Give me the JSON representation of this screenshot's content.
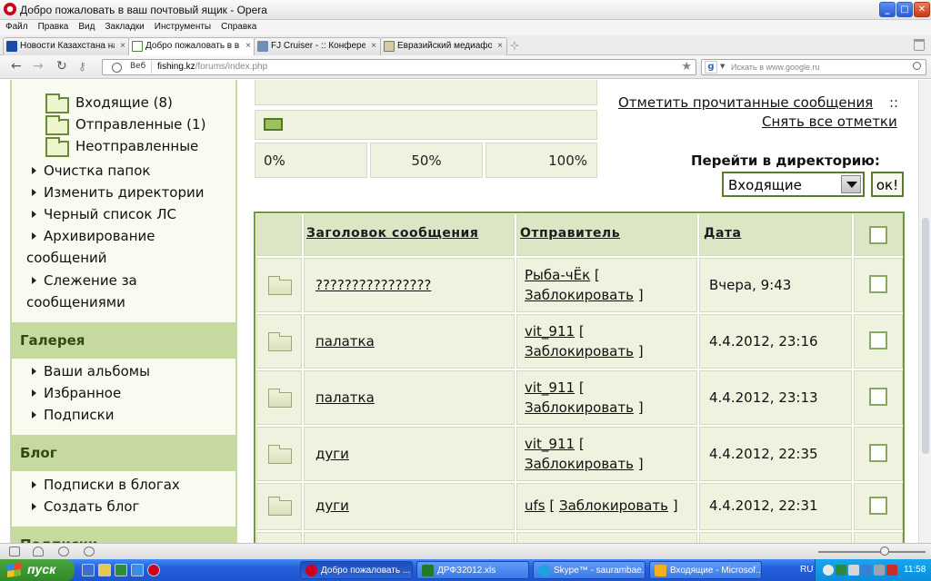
{
  "window": {
    "title": "Добро пожаловать в ваш почтовый ящик - Opera",
    "min_label": "_",
    "max_label": "□",
    "close_label": "✕"
  },
  "menu": [
    "Файл",
    "Правка",
    "Вид",
    "Закладки",
    "Инструменты",
    "Справка"
  ],
  "tabs": [
    {
      "label": "Новости Казахстана на...",
      "close": "×"
    },
    {
      "label": "Добро пожаловать в в...",
      "close": "×"
    },
    {
      "label": "FJ Cruiser - :: Конферен...",
      "close": "×"
    },
    {
      "label": "Евразийский медиафор...",
      "close": "×"
    }
  ],
  "address": {
    "badge": "Веб",
    "host": "fishing.kz",
    "path": "/forums/index.php",
    "search_placeholder": "Искать в www.google.ru",
    "search_engine": "g"
  },
  "sidebar": {
    "folders": [
      {
        "label": "Входящие (8)"
      },
      {
        "label": "Отправленные (1)"
      },
      {
        "label": "Неотправленные"
      }
    ],
    "links": [
      "Очистка папок",
      "Изменить директории",
      "Черный список ЛС",
      "Архивирование сообщений",
      "Слежение за сообщениями"
    ],
    "gallery_header": "Галерея",
    "gallery_links": [
      "Ваши альбомы",
      "Избранное",
      "Подписки"
    ],
    "blog_header": "Блог",
    "blog_links": [
      "Подписки в блогах",
      "Создать блог"
    ],
    "next_header": "Подписки"
  },
  "quota": {
    "fill_fraction": 0.06,
    "labels": [
      "0%",
      "50%",
      "100%"
    ]
  },
  "actions": {
    "mark_read": "Отметить прочитанные сообщения",
    "separator": "::",
    "unmark_all": "Снять все отметки",
    "goto_label": "Перейти в директорию:",
    "folder_selected": "Входящие",
    "ok": "ок!"
  },
  "table": {
    "headers": {
      "subject": "Заголовок сообщения",
      "sender": "Отправитель",
      "date": "Дата"
    },
    "block_label": "Заблокировать",
    "rows": [
      {
        "subject": "????????????????",
        "sender": "Рыба-чЁк",
        "date": "Вчера, 9:43",
        "inline": false
      },
      {
        "subject": "палатка",
        "sender": "vit_911",
        "date": "4.4.2012, 23:16",
        "inline": false
      },
      {
        "subject": "палатка",
        "sender": "vit_911",
        "date": "4.4.2012, 23:13",
        "inline": false
      },
      {
        "subject": "дуги",
        "sender": "vit_911",
        "date": "4.4.2012, 22:35",
        "inline": false
      },
      {
        "subject": "дуги",
        "sender": "ufs",
        "date": "4.4.2012, 22:31",
        "inline": true
      }
    ]
  },
  "taskbar": {
    "start": "пуск",
    "tasks": [
      {
        "label": "Добро пожаловать ...",
        "color": "#d0001c",
        "active": true
      },
      {
        "label": "ДРФЗ2012.xls",
        "color": "#1f7a2e",
        "active": false
      },
      {
        "label": "Skype™ - saurambae...",
        "color": "#1aa3e0",
        "active": false
      },
      {
        "label": "Входящие - Microsof...",
        "color": "#f2b01e",
        "active": false
      }
    ],
    "lang": "RU",
    "clock": "11:58"
  },
  "colors": {
    "sidebar_header": "#c6d99e",
    "table_border": "#6d9a3a",
    "cell_bg": "#eef2de"
  }
}
